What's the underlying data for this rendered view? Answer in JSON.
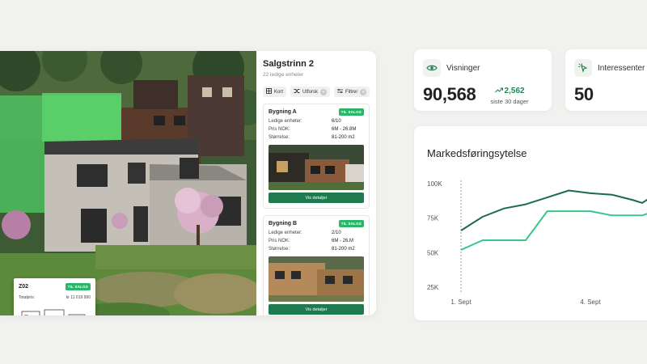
{
  "viewer": {
    "unit_card": {
      "code": "Z02",
      "badge": "TIL SALGS",
      "price_label": "Totalpris:",
      "price_value": "kr 11 019 990"
    },
    "sidebar": {
      "title": "Salgstrinn 2",
      "subtitle": "22 ledige enheter",
      "tools": [
        {
          "label": "Kort",
          "icon": "map-icon"
        },
        {
          "label": "Utforsk",
          "icon": "shuffle-icon"
        },
        {
          "label": "Filtrer",
          "icon": "sliders-icon"
        }
      ],
      "buildings": [
        {
          "name": "Bygning A",
          "badge": "TIL SALGS",
          "rows": [
            {
              "label": "Ledige enheter:",
              "value": "6/10"
            },
            {
              "label": "Pris NOK:",
              "value": "6M - 26.8M"
            },
            {
              "label": "Størrelse:",
              "value": "81-200 m2"
            }
          ],
          "button": "Vis detaljer"
        },
        {
          "name": "Bygning B",
          "badge": "TIL SALGS",
          "rows": [
            {
              "label": "Ledige enheter:",
              "value": "2/10"
            },
            {
              "label": "Pris NOK:",
              "value": "6M - 26.M"
            },
            {
              "label": "Størrelse:",
              "value": "81-200 m2"
            }
          ],
          "button": "Vis detaljer"
        }
      ]
    }
  },
  "stats": {
    "views": {
      "label": "Visninger",
      "value": "90,568",
      "delta": "2,562",
      "delta_sub": "siste 30 dager",
      "icon": "eye-icon"
    },
    "interested": {
      "label": "Interessenter",
      "value": "50",
      "icon": "cursor-click-icon"
    }
  },
  "chart_data": {
    "type": "line",
    "title": "Markedsføringsytelse",
    "xlabel": "",
    "ylabel": "",
    "x_ticks": [
      "1. Sept",
      "4. Sept"
    ],
    "y_ticks": [
      "100K",
      "75K",
      "50K",
      "25K"
    ],
    "ylim": [
      25000,
      100000
    ],
    "x": [
      1,
      1.5,
      2,
      2.5,
      3,
      3.5,
      4,
      4.5,
      5,
      5.2,
      5.5
    ],
    "series": [
      {
        "color": "#1e6b47",
        "values": [
          66000,
          76000,
          82000,
          85000,
          90000,
          95000,
          93000,
          92000,
          88000,
          86000,
          92000
        ]
      },
      {
        "color": "#3cc58a",
        "values": [
          52000,
          59000,
          59000,
          59000,
          80000,
          80000,
          80000,
          77000,
          77000,
          77000,
          80000
        ]
      }
    ],
    "grid": true,
    "legend": "none",
    "marker_x": 1,
    "colors": {
      "accent": "#1e7a4f",
      "badge": "#2bb56b"
    }
  }
}
